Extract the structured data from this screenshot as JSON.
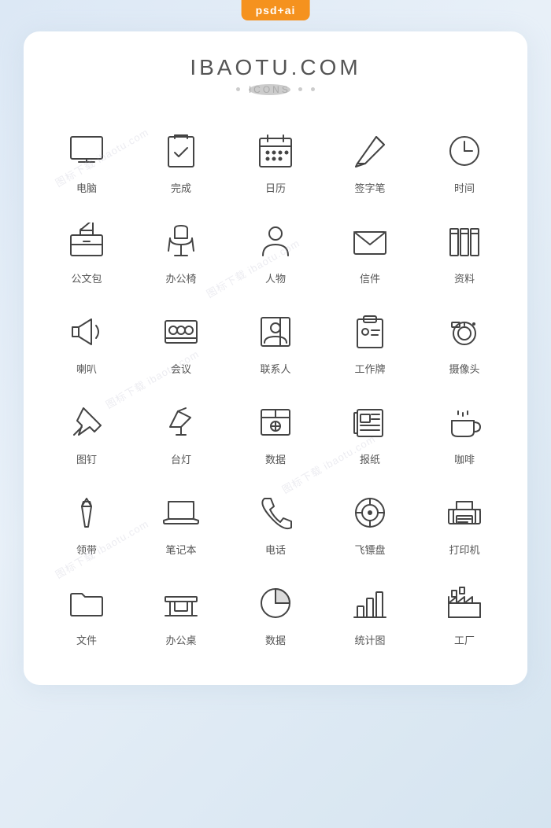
{
  "badge": "psd+ai",
  "title": "IBAOTU.COM",
  "subtitle": "ICONS",
  "icons": [
    {
      "id": "computer",
      "label": "电脑"
    },
    {
      "id": "complete",
      "label": "完成"
    },
    {
      "id": "calendar",
      "label": "日历"
    },
    {
      "id": "pen",
      "label": "签字笔"
    },
    {
      "id": "clock",
      "label": "时间"
    },
    {
      "id": "briefcase",
      "label": "公文包"
    },
    {
      "id": "chair",
      "label": "办公椅"
    },
    {
      "id": "person",
      "label": "人物"
    },
    {
      "id": "mail",
      "label": "信件"
    },
    {
      "id": "files",
      "label": "资料"
    },
    {
      "id": "megaphone",
      "label": "喇叭"
    },
    {
      "id": "meeting",
      "label": "会议"
    },
    {
      "id": "contact",
      "label": "联系人"
    },
    {
      "id": "badge",
      "label": "工作牌"
    },
    {
      "id": "camera",
      "label": "摄像头"
    },
    {
      "id": "pin",
      "label": "图钉"
    },
    {
      "id": "lamp",
      "label": "台灯"
    },
    {
      "id": "data",
      "label": "数据"
    },
    {
      "id": "newspaper",
      "label": "报纸"
    },
    {
      "id": "coffee",
      "label": "咖啡"
    },
    {
      "id": "tie",
      "label": "领带"
    },
    {
      "id": "laptop",
      "label": "笔记本"
    },
    {
      "id": "phone",
      "label": "电话"
    },
    {
      "id": "frisbee",
      "label": "飞镖盘"
    },
    {
      "id": "printer",
      "label": "打印机"
    },
    {
      "id": "folder",
      "label": "文件"
    },
    {
      "id": "desk",
      "label": "办公桌"
    },
    {
      "id": "piechart",
      "label": "数据"
    },
    {
      "id": "barchart",
      "label": "统计图"
    },
    {
      "id": "factory",
      "label": "工厂"
    }
  ]
}
